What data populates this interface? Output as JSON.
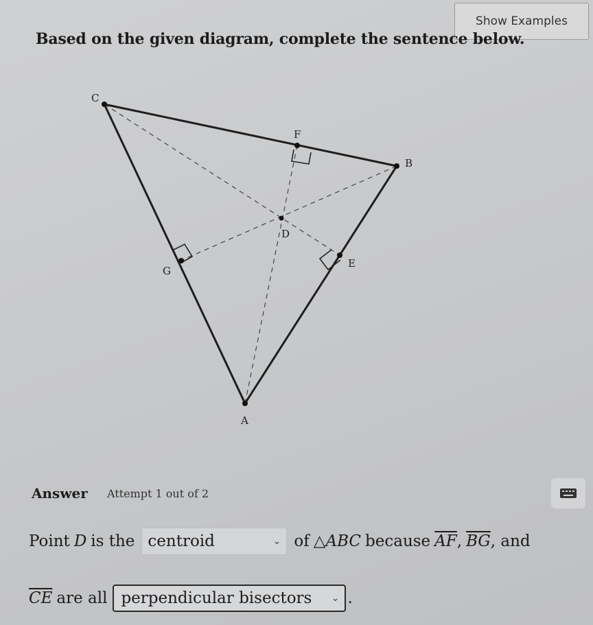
{
  "header": {
    "show_examples_label": "Show Examples"
  },
  "question": {
    "text": "Based on the given diagram, complete the sentence below."
  },
  "diagram": {
    "points": {
      "A": "A",
      "B": "B",
      "C": "C",
      "D": "D",
      "E": "E",
      "F": "F",
      "G": "G"
    }
  },
  "answer": {
    "label": "Answer",
    "attempt": "Attempt 1 out of 2",
    "keyboard_icon": "keyboard-icon"
  },
  "sentence": {
    "point_text": "Point",
    "point_var": "D",
    "is_the": "is the",
    "dropdown1_value": "centroid",
    "of_text": "of",
    "triangle": "△ABC",
    "because": "because",
    "seg_af": "AF",
    "comma1": ",",
    "seg_bg": "BG",
    "and_text": ", and",
    "seg_ce": "CE",
    "are_all": "are all",
    "dropdown2_value": "perpendicular bisectors",
    "period": "."
  },
  "colors": {
    "background": "#c8c9cb",
    "line": "#1e1e1e"
  }
}
